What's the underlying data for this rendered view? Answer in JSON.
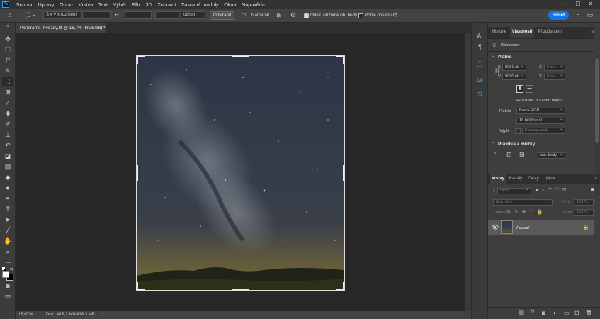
{
  "app": {
    "logo": "Ps"
  },
  "menu": [
    "Soubor",
    "Úpravy",
    "Obraz",
    "Vrstva",
    "Text",
    "Výběr",
    "Filtr",
    "3D",
    "Zobrazit",
    "Zásuvné moduly",
    "Okna",
    "Nápověda"
  ],
  "window_controls": {
    "minimize": "—",
    "maximize": "☐",
    "close": "✕"
  },
  "options": {
    "ratio_select": "Š x V x rozlišení",
    "unit_select": "ob/cm",
    "clear_label": "Odstranit",
    "straighten_label": "Narovnat",
    "delete_cropped_label": "Odstr. oříznuté ob. body",
    "delete_cropped_checked": true,
    "content_aware_label": "Podle obsahu",
    "content_aware_checked": false,
    "share_label": "Sdílet"
  },
  "document": {
    "tab_title": "Panorama_hvezdy.tif @ 16,7% (RGB/16) *",
    "tab_close": "×"
  },
  "status": {
    "zoom": "16,67%",
    "doc_info": "Dok.: 418,3 MB/418,3 MB",
    "arrow": "›"
  },
  "right_panel": {
    "tabs": [
      "Historie",
      "Vlastnosti",
      "Přizpůsobení"
    ],
    "active_tab": "Vlastnosti",
    "section_document": "Dokument",
    "canvas": {
      "title": "Plátno",
      "w_label": "Š",
      "w_value": "8051 ob",
      "h_label": "V",
      "h_value": "9080 ob",
      "x_label": "X",
      "x_value": "0 ob",
      "y_label": "Y",
      "y_value": "0 ob",
      "resolution": "Rozlišení: 300 obr. bodů/...",
      "mode_label": "Režim",
      "mode_value": "Barva RGB",
      "depth_value": "16 bitů/kanál",
      "fill_label": "Výplň",
      "fill_value": "Barva pozadí"
    },
    "rulers": {
      "title": "Pravítka a mřížky",
      "unit_value": "obr. body"
    },
    "layers": {
      "tabs": [
        "Vrstvy",
        "Kanály",
        "Cesty",
        "Akce"
      ],
      "active_tab": "Vrstvy",
      "filter_placeholder": "Druh",
      "blend_mode": "Normální",
      "opacity_label": "Krytí:",
      "opacity_value": "100 %",
      "lock_label": "Zámek:",
      "fill_label": "Výplň:",
      "fill_value": "100 %",
      "layer_name": "Pozadí",
      "footer_icons": [
        "link-icon",
        "fx-icon",
        "mask-icon",
        "adjustment-icon",
        "group-icon",
        "new-layer-icon",
        "trash-icon"
      ]
    }
  },
  "colors": {
    "accent": "#1473e6",
    "panel": "#3e3e3e",
    "canvas_bg": "#282828"
  }
}
